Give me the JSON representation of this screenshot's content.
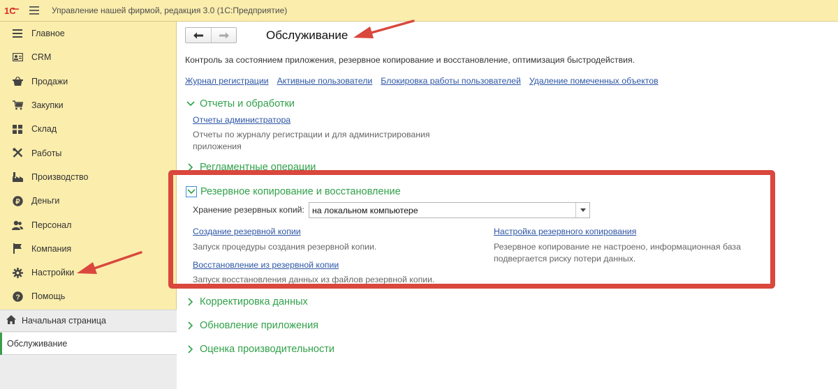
{
  "app": {
    "title": "Управление нашей фирмой, редакция 3.0  (1С:Предприятие)"
  },
  "sidebar": {
    "items": [
      {
        "label": "Главное",
        "icon": "menu-icon"
      },
      {
        "label": "CRM",
        "icon": "contact-card-icon"
      },
      {
        "label": "Продажи",
        "icon": "basket-icon"
      },
      {
        "label": "Закупки",
        "icon": "cart-icon"
      },
      {
        "label": "Склад",
        "icon": "warehouse-icon"
      },
      {
        "label": "Работы",
        "icon": "tools-icon"
      },
      {
        "label": "Производство",
        "icon": "factory-icon"
      },
      {
        "label": "Деньги",
        "icon": "ruble-icon"
      },
      {
        "label": "Персонал",
        "icon": "people-icon"
      },
      {
        "label": "Компания",
        "icon": "flag-icon"
      },
      {
        "label": "Настройки",
        "icon": "gear-icon"
      },
      {
        "label": "Помощь",
        "icon": "help-icon"
      }
    ],
    "home_label": "Начальная страница",
    "open_window_label": "Обслуживание"
  },
  "main": {
    "title": "Обслуживание",
    "description": "Контроль за состоянием приложения, резервное копирование и восстановление, оптимизация быстродействия.",
    "links": [
      "Журнал регистрации",
      "Активные пользователи",
      "Блокировка работы пользователей",
      "Удаление помеченных объектов"
    ],
    "sections": {
      "reports": {
        "title": "Отчеты и обработки",
        "link": "Отчеты администратора",
        "desc_line1": "Отчеты по журналу регистрации и для администрирования",
        "desc_line2": "приложения"
      },
      "scheduled": {
        "title": "Регламентные операции"
      },
      "backup": {
        "title": "Резервное копирование и восстановление",
        "storage_label": "Хранение резервных копий:",
        "storage_value": "на локальном компьютере",
        "create_link": "Создание резервной копии",
        "create_desc": "Запуск процедуры создания резервной копии.",
        "restore_link": "Восстановление из резервной копии",
        "restore_desc": "Запуск восстановления данных из файлов резервной копии.",
        "settings_link": "Настройка резервного копирования",
        "settings_desc_line1": "Резервное копирование не настроено, информационная база",
        "settings_desc_line2": "подвергается риску потери данных."
      },
      "correction": {
        "title": "Корректировка данных"
      },
      "update": {
        "title": "Обновление приложения"
      },
      "performance": {
        "title": "Оценка производительности"
      }
    }
  },
  "colors": {
    "sidebar_bg": "#fbedac",
    "section_green": "#31a14a",
    "link_blue": "#2d56a5",
    "annotation_red": "#d9473d",
    "logo_red": "#d92b27"
  }
}
